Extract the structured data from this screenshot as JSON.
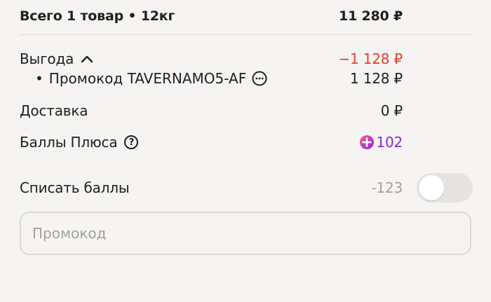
{
  "summary": {
    "label": "Всего 1 товар • 12кг",
    "value": "11 280 ₽"
  },
  "discount": {
    "label": "Выгода",
    "value": "−1 128 ₽",
    "promo_bullet": "•",
    "promo_label": "Промокод TAVERNAMO5-AF",
    "promo_value": "1 128 ₽"
  },
  "delivery": {
    "label": "Доставка",
    "value": "0 ₽"
  },
  "plus_points": {
    "label": "Баллы Плюса",
    "help_icon": "?",
    "value": "102"
  },
  "spend_points": {
    "label": "Списать баллы",
    "value": "-123",
    "toggle_on": false
  },
  "promo_input": {
    "placeholder": "Промокод",
    "value": ""
  },
  "colors": {
    "discount_red": "#e0402b",
    "plus_purple": "#8a2bd9",
    "muted": "#a3a19d"
  }
}
